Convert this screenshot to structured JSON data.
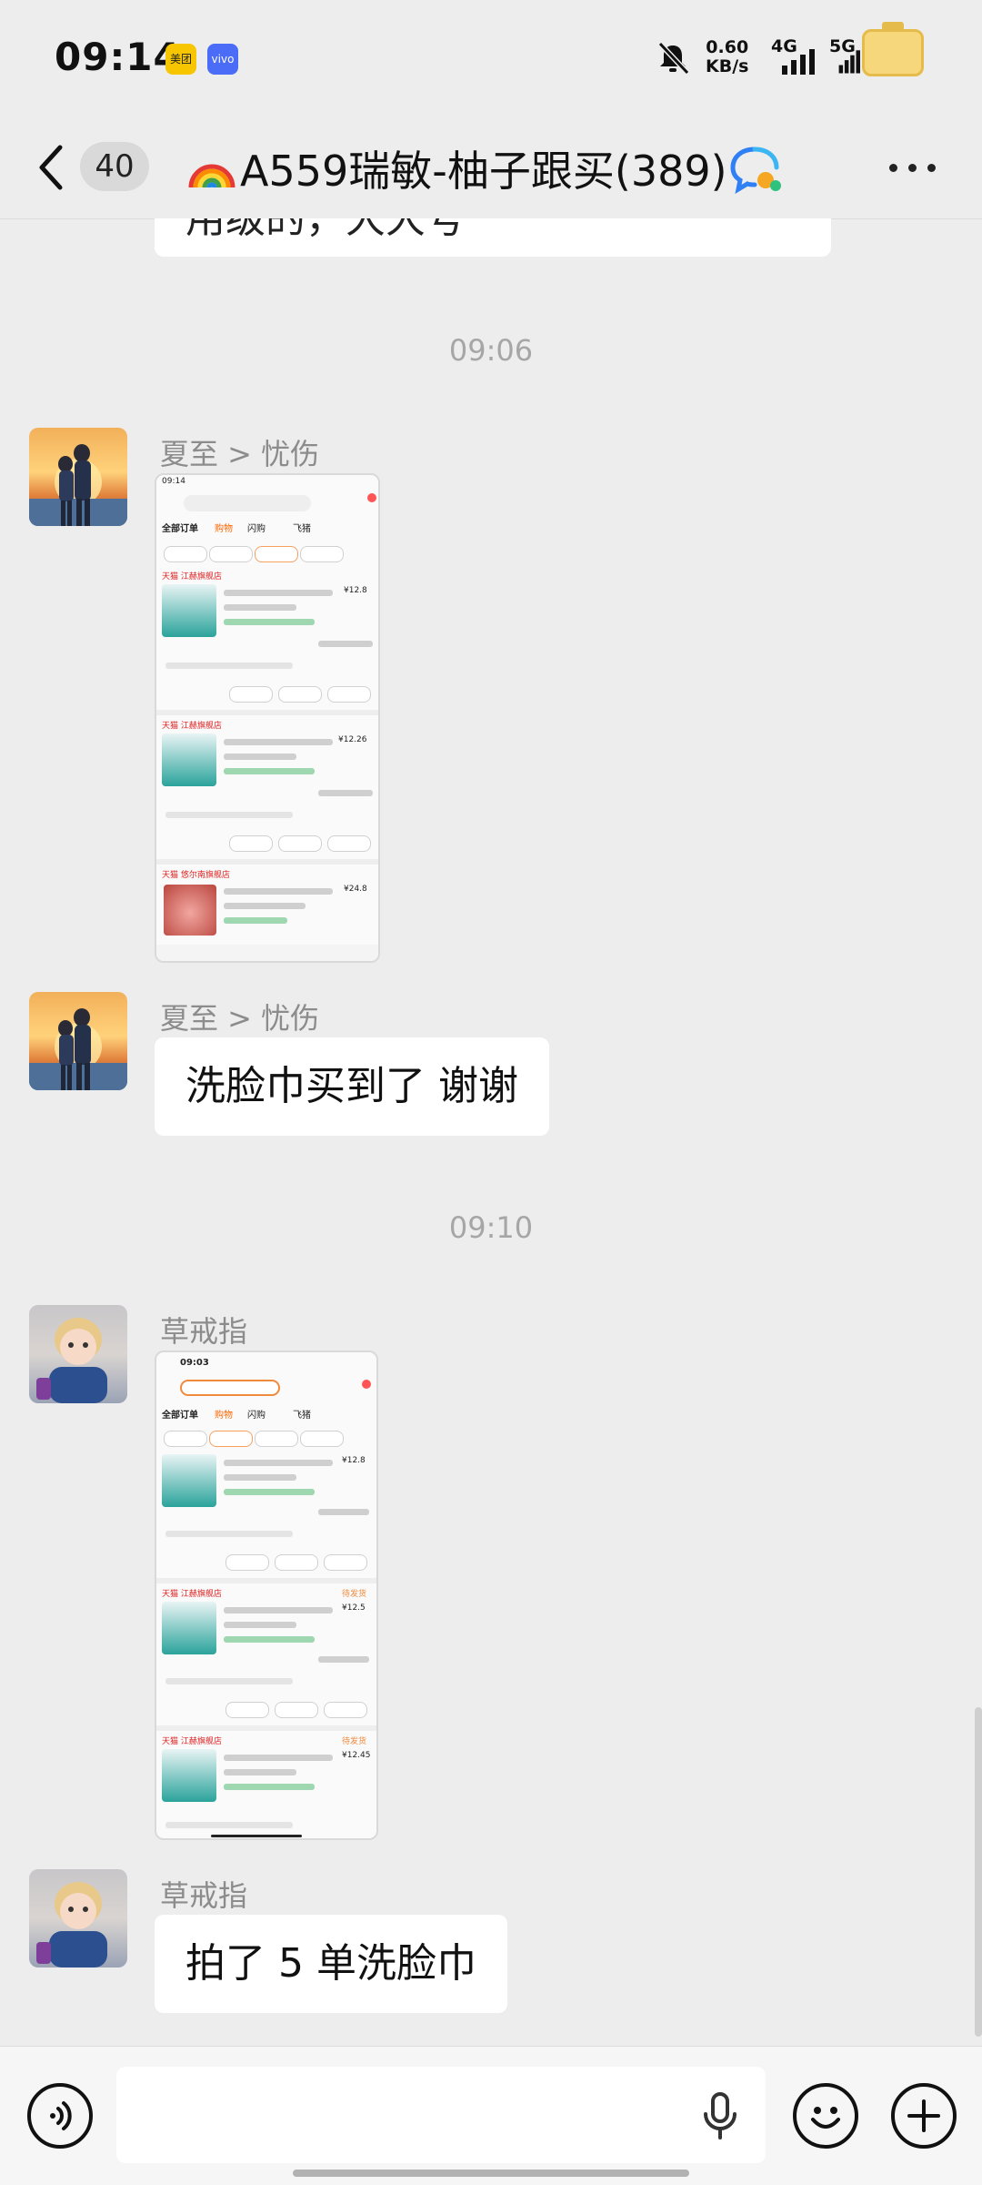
{
  "status_bar": {
    "time": "09:14",
    "apps": [
      "美团",
      "vivo"
    ],
    "speed_value": "0.60",
    "speed_unit": "KB/s",
    "net1": "4G",
    "net2": "5G"
  },
  "header": {
    "unread_count": "40",
    "title": "A559瑞敏-柚子跟买(389)",
    "icons": [
      "back-icon",
      "rainbow-icon",
      "group-chat-icon",
      "more-icon"
    ]
  },
  "partial_message": "用级的，大大号",
  "messages": [
    {
      "type": "timestamp",
      "text": "09:06"
    },
    {
      "type": "image",
      "sender": "夏至 > 忧伤",
      "avatar": "couple-avatar",
      "image": {
        "tabs": [
          "全部订单",
          "购物",
          "闪购",
          "飞猪"
        ],
        "shops": [
          "天猫 江赫旗舰店",
          "天猫 江赫旗舰店",
          "天猫 悠尔南旗舰店"
        ],
        "prices": [
          "¥12.8",
          "¥12.26",
          "¥24.8"
        ]
      }
    },
    {
      "type": "text",
      "sender": "夏至 > 忧伤",
      "avatar": "couple-avatar",
      "text": "洗脸巾买到了 谢谢"
    },
    {
      "type": "timestamp",
      "text": "09:10"
    },
    {
      "type": "image",
      "sender": "草戒指",
      "avatar": "child-avatar",
      "image": {
        "time": "09:03",
        "tabs": [
          "全部订单",
          "购物",
          "闪购",
          "飞猪"
        ],
        "shops": [
          "天猫 江赫旗舰店",
          "天猫 江赫旗舰店"
        ],
        "prices": [
          "¥12.8",
          "¥12.5",
          "¥12.45"
        ],
        "status": "待发货"
      }
    },
    {
      "type": "text",
      "sender": "草戒指",
      "avatar": "child-avatar",
      "text": "拍了 5 单洗脸巾"
    }
  ],
  "input_bar": {
    "input_value": "",
    "icons": [
      "voice-icon",
      "mic-icon",
      "emoji-icon",
      "plus-icon"
    ]
  },
  "colors": {
    "background": "#ededed",
    "bubble": "#ffffff",
    "timestamp": "#a6a6a6",
    "sender": "#8c8c8c"
  }
}
